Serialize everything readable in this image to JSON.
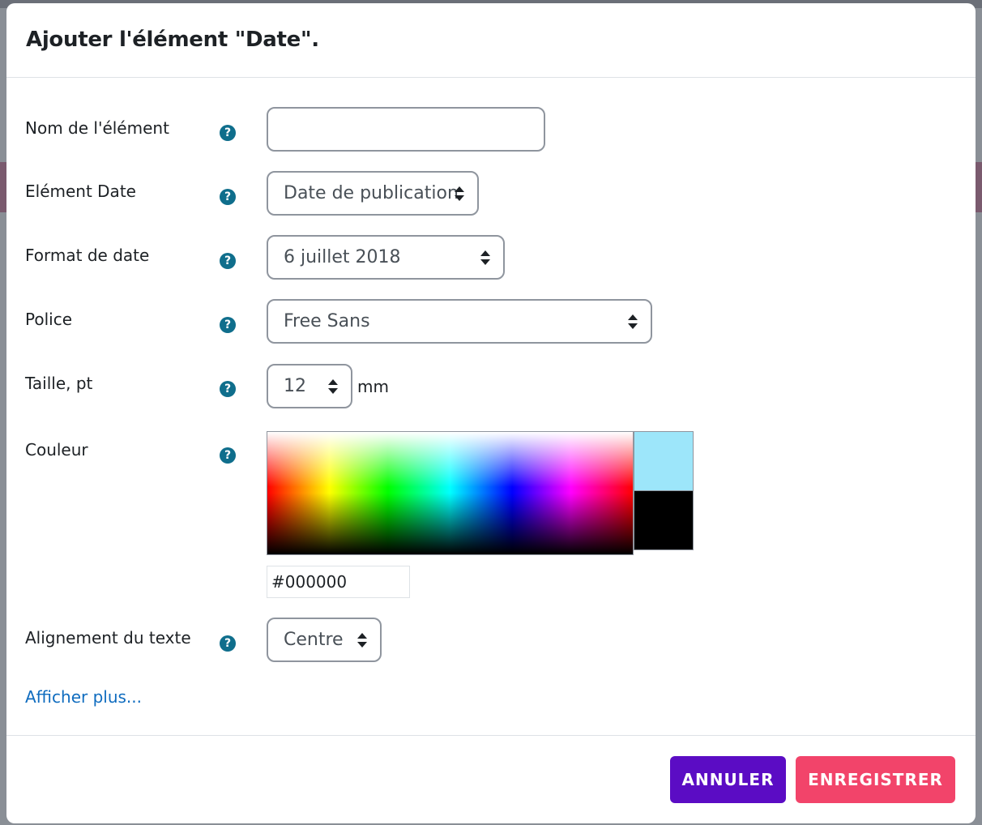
{
  "dialog": {
    "title": "Ajouter l'élément \"Date\".",
    "help_glyph": "?"
  },
  "fields": {
    "name": {
      "label": "Nom de l'élément",
      "value": ""
    },
    "date_element": {
      "label": "Elément Date",
      "value": "Date de publication"
    },
    "date_format": {
      "label": "Format de date",
      "value": "6 juillet 2018"
    },
    "font": {
      "label": "Police",
      "value": "Free Sans"
    },
    "size": {
      "label": "Taille, pt",
      "value": "12",
      "unit": "mm"
    },
    "color": {
      "label": "Couleur",
      "value": "#000000",
      "preview_current": "#9de6fa",
      "preview_selected": "#000000"
    },
    "alignment": {
      "label": "Alignement du texte",
      "value": "Centre"
    }
  },
  "more_link": "Afficher plus...",
  "buttons": {
    "cancel": "ANNULER",
    "save": "ENREGISTRER"
  },
  "colors": {
    "primary": "#5b0cc4",
    "accent": "#f2446a",
    "help_icon": "#0f6e8c",
    "link": "#0f6cbf"
  }
}
